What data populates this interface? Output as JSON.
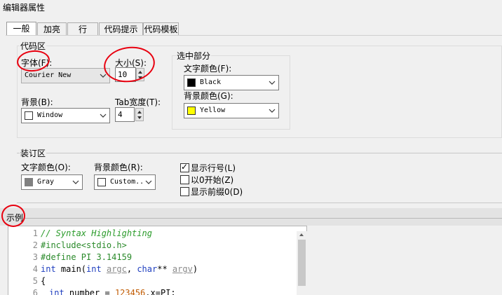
{
  "window": {
    "title": "编辑器属性"
  },
  "tabs": [
    "一般",
    "加亮",
    "行",
    "代码提示",
    "代码模板"
  ],
  "code_area": {
    "title": "代码区",
    "font_label": "字体(F):",
    "font_value": "Courier New",
    "size_label": "大小(S):",
    "size_value": "10",
    "background_label": "背景(B):",
    "background_value": "Window",
    "tab_width_label": "Tab宽度(T):",
    "tab_width_value": "4",
    "selection": {
      "title": "选中部分",
      "text_color_label": "文字颜色(F):",
      "text_color_value": "Black",
      "text_color_swatch": "#000000",
      "bg_color_label": "背景颜色(G):",
      "bg_color_value": "Yellow",
      "bg_color_swatch": "#ffff00"
    }
  },
  "gutter": {
    "title": "装订区",
    "text_color_label": "文字颜色(O):",
    "text_color_value": "Gray",
    "text_color_swatch": "#808080",
    "bg_color_label": "背景颜色(R):",
    "bg_color_value": "Custom..",
    "bg_color_swatch": "#ffffff",
    "show_line_numbers": {
      "label": "显示行号(L)",
      "checked": true
    },
    "start_at_zero": {
      "label": "以0开始(Z)",
      "checked": false
    },
    "show_leading_zeros": {
      "label": "显示前缀0(D)",
      "checked": false
    }
  },
  "example": {
    "title": "示例",
    "line_numbers": [
      "1",
      "2",
      "3",
      "4",
      "5",
      "6"
    ],
    "lines": {
      "l1": "// Syntax Highlighting",
      "l2": "#include<stdio.h>",
      "l3": "#define PI 3.14159",
      "l4_kw1": "int",
      "l4_name": " main(",
      "l4_kw2": "int",
      "l4_argc": "argc",
      "l4_sep": ", ",
      "l4_kw3": "char",
      "l4_ptr": "** ",
      "l4_argv": "argv",
      "l4_end": ")",
      "l5": "{",
      "l6_kw": "int",
      "l6_mid": " number = ",
      "l6_num": "123456",
      "l6_end": ".x=PI;"
    }
  },
  "annotation_color": "#e8000f"
}
